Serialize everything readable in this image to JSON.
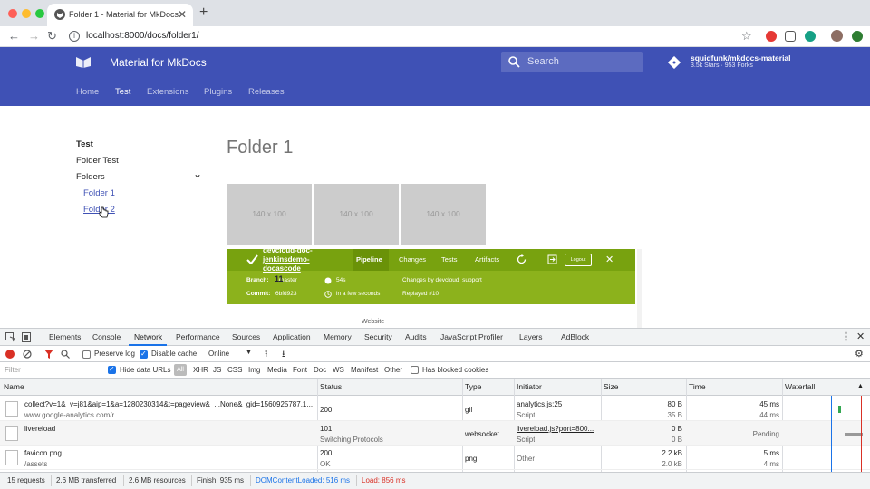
{
  "browser": {
    "tab_title": "Folder 1 - Material for MkDocs",
    "tab_close": "✕",
    "new_tab": "+",
    "url": "localhost:8000/docs/folder1/",
    "back": "←",
    "forward": "→",
    "reload": "↻",
    "bookmark": "☆"
  },
  "header": {
    "site_name": "Material for MkDocs",
    "search_placeholder": "Search",
    "repo_name": "squidfunk/mkdocs-material",
    "repo_facts": "3.5k Stars · 953 Forks"
  },
  "tabs": [
    "Home",
    "Test",
    "Extensions",
    "Plugins",
    "Releases"
  ],
  "sidebar": {
    "section": "Test",
    "items": [
      "Folder Test",
      "Folders"
    ],
    "sub_items": [
      "Folder 1",
      "Folder 2"
    ],
    "expand_icon": "⌄"
  },
  "content": {
    "title": "Folder 1",
    "thumbs": [
      "140 x 100",
      "140 x 100",
      "140 x 100"
    ],
    "pipeline": {
      "run_name": "devcloud-doc-jenkinsdemo-docascode",
      "tabs": [
        "Pipeline",
        "Changes",
        "Tests",
        "Artifacts"
      ],
      "logout": "Logout",
      "close": "✕",
      "branch_label": "Branch:",
      "branch_value": "master",
      "commit_label": "Commit:",
      "commit_value": "6bfd923",
      "duration": "54s",
      "when": "in a few seconds",
      "changes_by": "Changes by devcloud_support",
      "replayed": "Replayed #10",
      "overlay_number": "11"
    },
    "website_label": "Website"
  },
  "devtools": {
    "tabs": [
      "Elements",
      "Console",
      "Network",
      "Performance",
      "Sources",
      "Application",
      "Memory",
      "Security",
      "Audits",
      "JavaScript Profiler",
      "Layers",
      "AdBlock"
    ],
    "preserve_log": "Preserve log",
    "disable_cache": "Disable cache",
    "throttle": "Online",
    "filter_placeholder": "Filter",
    "hide_data_urls": "Hide data URLs",
    "type_filters": [
      "All",
      "XHR",
      "JS",
      "CSS",
      "Img",
      "Media",
      "Font",
      "Doc",
      "WS",
      "Manifest",
      "Other"
    ],
    "has_blocked_cookies": "Has blocked cookies",
    "columns": [
      "Name",
      "Status",
      "Type",
      "Initiator",
      "Size",
      "Time",
      "Waterfall"
    ],
    "rows": [
      {
        "name": "collect?v=1&_v=j81&aip=1&a=1280230314&t=pageview&_...None&_gid=1560925787.1...",
        "domain": "www.google-analytics.com/r",
        "status": "200",
        "status_text": "",
        "type": "gif",
        "initiator": "analytics.js:25",
        "initiator_type": "Script",
        "size": "80 B",
        "size_res": "35 B",
        "time": "45 ms",
        "latency": "44 ms"
      },
      {
        "name": "livereload",
        "domain": "",
        "status": "101",
        "status_text": "Switching Protocols",
        "type": "websocket",
        "initiator": "livereload.js?port=800...",
        "initiator_type": "Script",
        "size": "0 B",
        "size_res": "0 B",
        "time": "Pending",
        "latency": ""
      },
      {
        "name": "favicon.png",
        "domain": "/assets",
        "status": "200",
        "status_text": "OK",
        "type": "png",
        "initiator": "Other",
        "initiator_type": "",
        "size": "2.2 kB",
        "size_res": "2.0 kB",
        "time": "5 ms",
        "latency": "4 ms"
      }
    ],
    "status": {
      "requests": "15 requests",
      "transferred": "2.6 MB transferred",
      "resources": "2.6 MB resources",
      "finish": "Finish: 935 ms",
      "dom_loaded": "DOMContentLoaded: 516 ms",
      "load": "Load: 856 ms"
    }
  },
  "colors": {
    "primary": "#3f51b5",
    "pipeline_green": "#8cb21c",
    "dom_blue": "#1a73e8",
    "load_red": "#d93025"
  }
}
